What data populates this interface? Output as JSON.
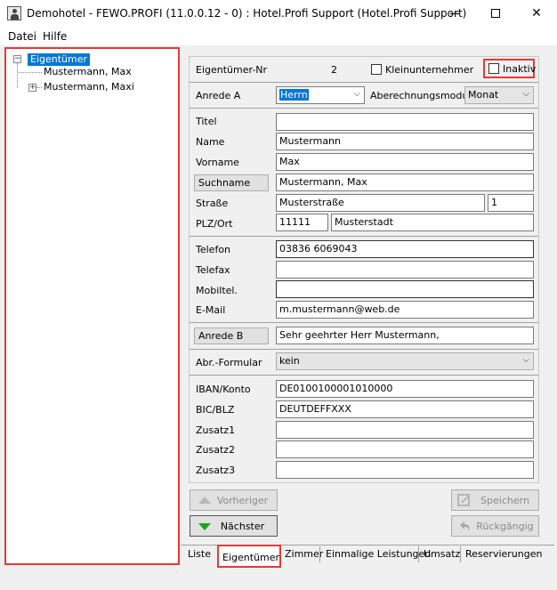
{
  "window": {
    "title": "Demohotel - FEWO.PROFI (11.0.0.12 - 0) : Hotel.Profi Support (Hotel.Profi Support)",
    "minimize": "",
    "close": "✕"
  },
  "menu": {
    "items": [
      "Datei",
      "Hilfe"
    ]
  },
  "tree": {
    "root_label": "Eigentümer",
    "items": [
      {
        "label": "Mustermann, Max"
      },
      {
        "label": "Mustermann, Maxi"
      }
    ]
  },
  "form": {
    "eigentuemer_nr_label": "Eigentümer-Nr",
    "eigentuemer_nr_value": "2",
    "kleinunternehmer_label": "Kleinunternehmer",
    "kleinunternehmer_checked": false,
    "inaktiv_label": "Inaktiv",
    "inaktiv_checked": false,
    "anrede_a_label": "Anrede A",
    "anrede_a_value": "Herrn",
    "abrechnungsmodus_label": "Aberechnungsmodus",
    "abrechnungsmodus_value": "Monat",
    "titel_label": "Titel",
    "titel_value": "",
    "name_label": "Name",
    "name_value": "Mustermann",
    "vorname_label": "Vorname",
    "vorname_value": "Max",
    "suchname_label": "Suchname",
    "suchname_value": "Mustermann, Max",
    "strasse_label": "Straße",
    "strasse_value": "Musterstraße",
    "hausnr_value": "1",
    "plz_ort_label": "PLZ/Ort",
    "plz_value": "11111",
    "ort_value": "Musterstadt",
    "telefon_label": "Telefon",
    "telefon_value": "03836 6069043",
    "telefax_label": "Telefax",
    "telefax_value": "",
    "mobiltel_label": "Mobiltel.",
    "mobiltel_value": "",
    "email_label": "E-Mail",
    "email_value": "m.mustermann@web.de",
    "anrede_b_label": "Anrede B",
    "anrede_b_value": "Sehr geehrter Herr Mustermann,",
    "abr_formular_label": "Abr.-Formular",
    "abr_formular_value": "kein",
    "iban_label": "IBAN/Konto",
    "iban_value": "DE0100100001010000",
    "bic_label": "BIC/BLZ",
    "bic_value": "DEUTDEFFXXX",
    "zusatz1_label": "Zusatz1",
    "zusatz1_value": "",
    "zusatz2_label": "Zusatz2",
    "zusatz2_value": "",
    "zusatz3_label": "Zusatz3",
    "zusatz3_value": ""
  },
  "nav": {
    "vorheriger_label": "Vorheriger",
    "naechster_label": "Nächster",
    "speichern_label": "Speichern",
    "rueckgaengig_label": "Rückgängig"
  },
  "tabs": [
    {
      "label": "Liste",
      "active": false
    },
    {
      "label": "Eigentümer",
      "active": true
    },
    {
      "label": "Zimmer",
      "active": false
    },
    {
      "label": "Einmalige Leistungen",
      "active": false
    },
    {
      "label": "Umsatz",
      "active": false
    },
    {
      "label": "Reservierungen",
      "active": false
    }
  ],
  "colors": {
    "highlight": "#e53935",
    "selection": "#0078d7",
    "next_arrow": "#1aa51a"
  }
}
